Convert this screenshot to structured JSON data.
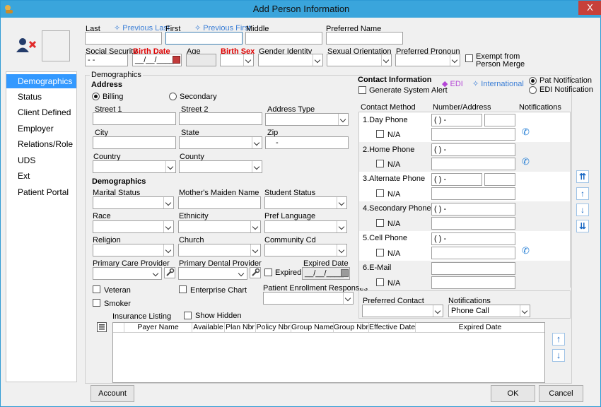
{
  "window": {
    "title": "Add Person Information",
    "close_label": "X"
  },
  "name": {
    "last_label": "Last",
    "previous_last": "Previous Last",
    "first_label": "First",
    "previous_first": "Previous First",
    "middle_label": "Middle",
    "preferred_label": "Preferred Name"
  },
  "identity": {
    "ssn_label": "Social Security",
    "ssn_value": "- -",
    "birth_date_label": "Birth Date",
    "birth_date_value": "__/__/____",
    "age_label": "Age",
    "birth_sex_label": "Birth Sex",
    "gender_label": "Gender Identity",
    "orientation_label": "Sexual Orientation",
    "pronoun_label": "Preferred Pronoun",
    "exempt_label_1": "Exempt from",
    "exempt_label_2": "Person Merge"
  },
  "sidebar": {
    "items": [
      {
        "label": "Demographics"
      },
      {
        "label": "Status"
      },
      {
        "label": "Client Defined"
      },
      {
        "label": "Employer"
      },
      {
        "label": "Relations/Role"
      },
      {
        "label": "UDS"
      },
      {
        "label": "Ext"
      },
      {
        "label": "Patient Portal"
      }
    ]
  },
  "demographics": {
    "group_label": "Demographics",
    "address_heading": "Address",
    "billing_label": "Billing",
    "secondary_label": "Secondary",
    "street1_label": "Street 1",
    "street2_label": "Street 2",
    "address_type_label": "Address Type",
    "city_label": "City",
    "state_label": "State",
    "zip_label": "Zip",
    "zip_value": "-",
    "country_label": "Country",
    "county_label": "County",
    "demographics_heading": "Demographics",
    "marital_label": "Marital Status",
    "maiden_label": "Mother's Maiden Name",
    "student_label": "Student Status",
    "race_label": "Race",
    "ethnicity_label": "Ethnicity",
    "pref_language_label": "Pref Language",
    "religion_label": "Religion",
    "church_label": "Church",
    "community_label": "Community Cd",
    "pcp_label": "Primary Care Provider",
    "pdp_label": "Primary Dental Provider",
    "expired_label": "Expired",
    "expired_date_label": "Expired Date",
    "expired_date_value": "__/__/____",
    "veteran_label": "Veteran",
    "enterprise_label": "Enterprise Chart",
    "enrollment_label": "Patient Enrollment Responses",
    "smoker_label": "Smoker"
  },
  "contact": {
    "heading": "Contact Information",
    "edi_label": "EDI",
    "international_label": "International",
    "pat_notification_label": "Pat Notification",
    "edi_notification_label": "EDI Notification",
    "generate_alert_label": "Generate System Alert",
    "col_method": "Contact Method",
    "col_number": "Number/Address",
    "col_notifications": "Notifications",
    "na_label": "N/A",
    "rows": [
      {
        "label": "1.Day Phone",
        "value": "(  )   -"
      },
      {
        "label": "2.Home Phone",
        "value": "(  )   -"
      },
      {
        "label": "3.Alternate Phone",
        "value": "(  )   -"
      },
      {
        "label": "4.Secondary Phone",
        "value": "(  )   -"
      },
      {
        "label": "5.Cell Phone",
        "value": "(  )   -"
      },
      {
        "label": "6.E-Mail",
        "value": ""
      }
    ],
    "preferred_contact_label": "Preferred Contact",
    "notifications_label": "Notifications",
    "notifications_value": "Phone Call"
  },
  "insurance": {
    "listing_label": "Insurance Listing",
    "show_hidden_label": "Show Hidden",
    "columns": [
      "Payer Name",
      "Available",
      "Plan Nbr",
      "Policy Nbr",
      "Group Name",
      "Group Nbr",
      "Effective Date",
      "Expired Date"
    ]
  },
  "footer": {
    "account_label": "Account",
    "ok_label": "OK",
    "cancel_label": "Cancel"
  },
  "colors": {
    "titlebar": "#3aa5dc",
    "close": "#c7403a",
    "nav_active": "#3399ff",
    "required": "#e00000",
    "link": "#3c7fd6"
  }
}
